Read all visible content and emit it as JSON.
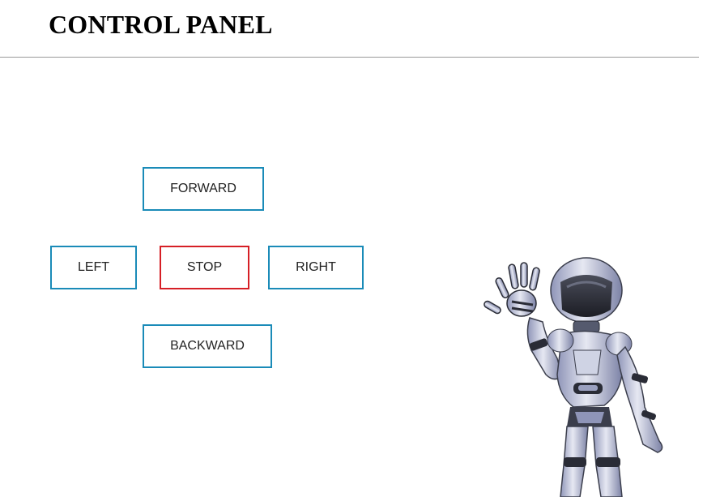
{
  "header": {
    "title": "CONTROL PANEL"
  },
  "controls": {
    "forward": "FORWARD",
    "left": "LEFT",
    "stop": "STOP",
    "right": "RIGHT",
    "backward": "BACKWARD"
  },
  "illustration": {
    "icon": "waving-robot-icon"
  },
  "colors": {
    "button_border": "#1a8bb8",
    "stop_border": "#d61f26",
    "divider": "#9a9a9a"
  }
}
